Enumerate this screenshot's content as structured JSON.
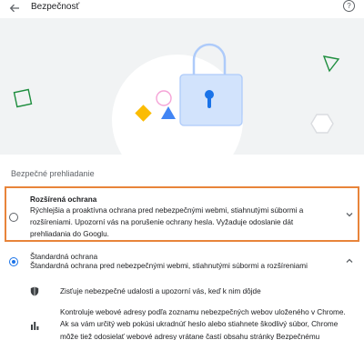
{
  "header": {
    "title": "Bezpečnosť",
    "help_glyph": "?"
  },
  "section": {
    "title": "Bezpečné prehliadanie"
  },
  "options": [
    {
      "title": "Rozšírená ochrana",
      "description": "Rýchlejšia a proaktívna ochrana pred nebezpečnými webmi, stiahnutými súbormi a rozšíreniami. Upozorní vás na porušenie ochrany hesla. Vyžaduje odoslanie dát prehliadania do Googlu.",
      "selected": false,
      "expanded": false
    },
    {
      "title": "Štandardná ochrana",
      "description": "Štandardná ochrana pred nebezpečnými webmi, stiahnutými súbormi a rozšíreniami",
      "selected": true,
      "expanded": true
    }
  ],
  "standard_details": [
    {
      "icon": "shield-icon",
      "text": "Zisťuje nebezpečné udalosti a upozorní vás, keď k nim dôjde"
    },
    {
      "icon": "bar-chart-icon",
      "text": "Kontroluje webové adresy podľa zoznamu nebezpečných webov uloženého v Chrome. Ak sa vám určitý web pokúsi ukradnúť heslo alebo stiahnete škodlivý súbor, Chrome môže tiež odosielať webové adresy vrátane častí obsahu stránky Bezpečnému prehliadaniu."
    }
  ],
  "colors": {
    "accent": "#1a73e8",
    "highlight_border": "#e8843a",
    "hero_bg": "#f1f3f4",
    "lock_body": "#d2e3fc",
    "diamond_yellow": "#fbbc04",
    "triangle_blue": "#4285f4",
    "square_green": "#1e8e3e",
    "circle_pink": "#f5a3d7"
  }
}
